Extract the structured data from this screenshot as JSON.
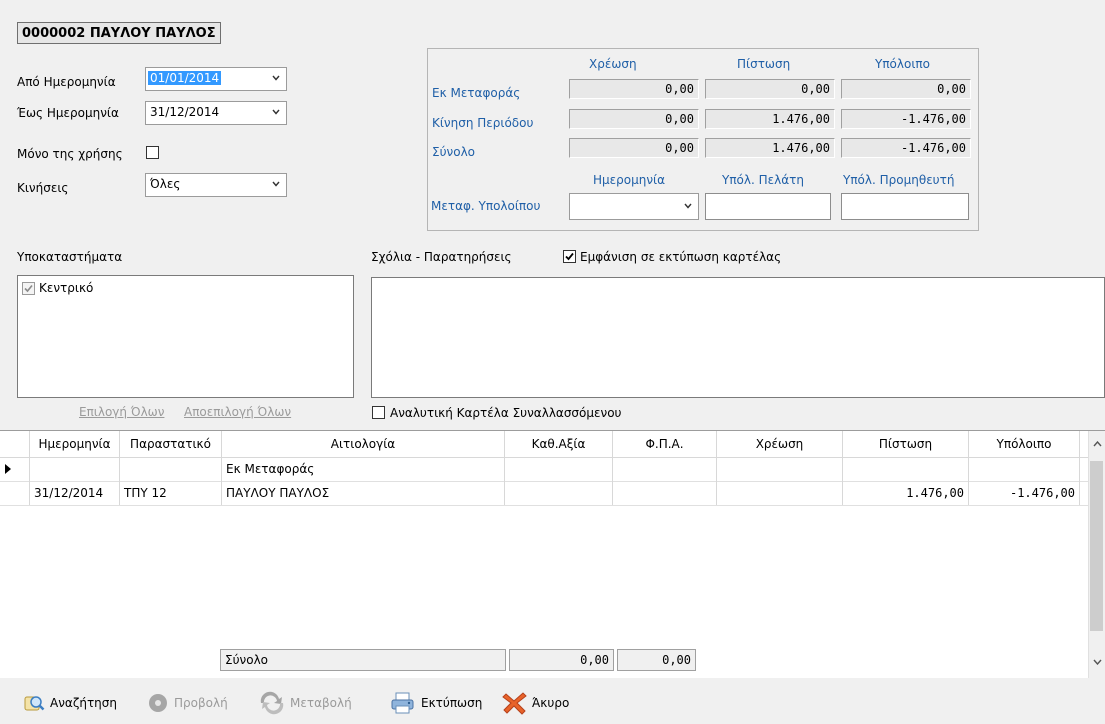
{
  "header": {
    "title": "0000002 ΠΑΥΛΟΥ ΠΑΥΛΟΣ"
  },
  "filters": {
    "from_label": "Από Ημερομηνία",
    "from_value": "01/01/2014",
    "to_label": "Έως Ημερομηνία",
    "to_value": "31/12/2014",
    "only_fiscal_label": "Μόνο της χρήσης",
    "movements_label": "Κινήσεις",
    "movements_value": "Όλες"
  },
  "summary": {
    "col_debit": "Χρέωση",
    "col_credit": "Πίστωση",
    "col_balance": "Υπόλοιπο",
    "rows": [
      {
        "label": "Εκ Μεταφοράς",
        "debit": "0,00",
        "credit": "0,00",
        "balance": "0,00"
      },
      {
        "label": "Κίνηση Περιόδου",
        "debit": "0,00",
        "credit": "1.476,00",
        "balance": "-1.476,00"
      },
      {
        "label": "Σύνολο",
        "debit": "0,00",
        "credit": "1.476,00",
        "balance": "-1.476,00"
      }
    ],
    "transfer_label": "Μεταφ. Υπολοίπου",
    "col_date": "Ημερομηνία",
    "col_customer_bal": "Υπόλ. Πελάτη",
    "col_supplier_bal": "Υπόλ. Προμηθευτή"
  },
  "branches": {
    "label": "Υποκαταστήματα",
    "items": [
      {
        "label": "Κεντρικό",
        "checked": true
      }
    ],
    "select_all": "Επιλογή Όλων",
    "deselect_all": "Αποεπιλογή Όλων"
  },
  "comments": {
    "label": "Σχόλια - Παρατηρήσεις",
    "show_in_print_label": "Εμφάνιση σε εκτύπωση καρτέλας",
    "show_in_print_checked": true,
    "analytic_label": "Αναλυτική Καρτέλα Συναλλασσόμενου",
    "analytic_checked": false
  },
  "grid": {
    "columns": [
      "Ημερομηνία",
      "Παραστατικό",
      "Αιτιολογία",
      "Καθ.Αξία",
      "Φ.Π.Α.",
      "Χρέωση",
      "Πίστωση",
      "Υπόλοιπο"
    ],
    "rows": [
      [
        "",
        "",
        "Εκ Μεταφοράς",
        "",
        "",
        "",
        "",
        ""
      ],
      [
        "31/12/2014",
        "ΤΠΥ 12",
        "ΠΑΥΛΟΥ ΠΑΥΛΟΣ",
        "",
        "",
        "",
        "1.476,00",
        "-1.476,00"
      ]
    ],
    "footer": {
      "label": "Σύνολο",
      "net": "0,00",
      "vat": "0,00"
    }
  },
  "toolbar": {
    "search": "Αναζήτηση",
    "view": "Προβολή",
    "edit": "Μεταβολή",
    "print": "Εκτύπωση",
    "cancel": "Άκυρο"
  }
}
